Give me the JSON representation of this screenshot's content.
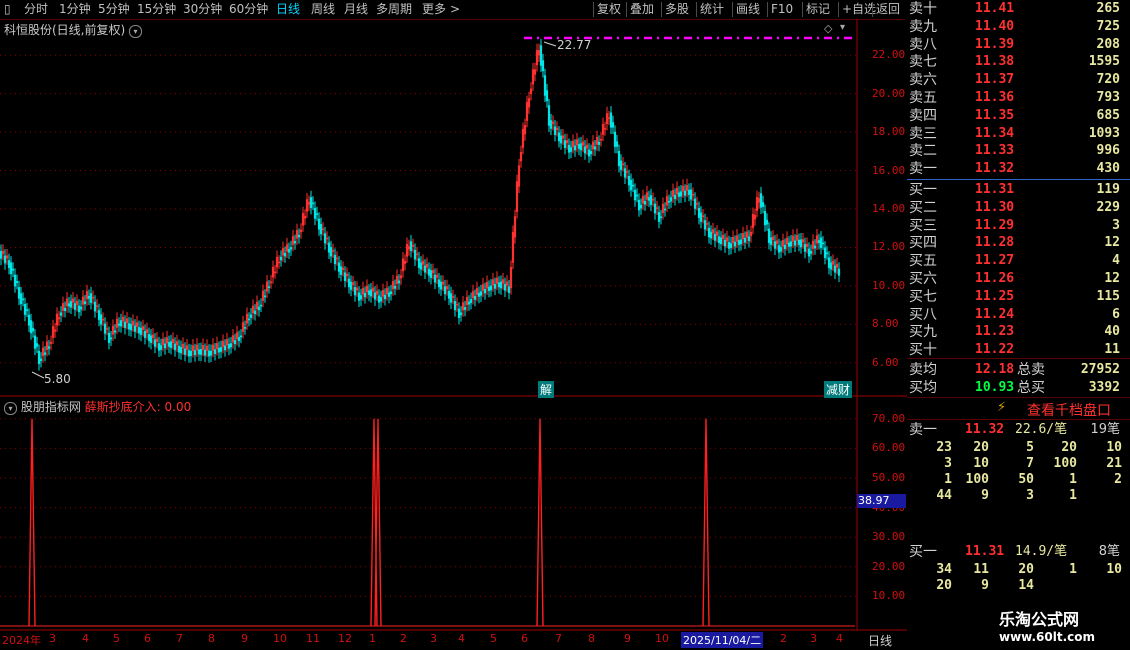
{
  "toolbar": {
    "periods": [
      "分时",
      "1分钟",
      "5分钟",
      "15分钟",
      "30分钟",
      "60分钟",
      "日线",
      "周线",
      "月线",
      "多周期",
      "更多"
    ],
    "active_period": "日线",
    "actions": [
      "复权",
      "叠加",
      "多股",
      "统计",
      "画线",
      "F10",
      "标记",
      "+自选",
      "返回"
    ]
  },
  "stock": {
    "title": "科恒股份(日线,前复权)",
    "high_label": "22.77",
    "low_label": "5.80",
    "badge_left": "解",
    "badge_right": "减财"
  },
  "indicator": {
    "panel_title": "股朋指标网",
    "name": "薛斯抄底介入: 0.00",
    "current_value": "38.97"
  },
  "bottom_axis": {
    "labels": [
      "2024年",
      "3",
      "4",
      "5",
      "6",
      "7",
      "8",
      "9",
      "10",
      "11",
      "12",
      "1",
      "2",
      "3",
      "4",
      "5",
      "6",
      "7",
      "8",
      "9",
      "10",
      "2025/11/04/二",
      "2",
      "3",
      "4"
    ],
    "period_label": "日线"
  },
  "chart_data": [
    {
      "type": "line",
      "name": "price",
      "ylim": [
        5,
        23
      ],
      "yticks": [
        "6.00",
        "8.00",
        "10.00",
        "12.00",
        "14.00",
        "16.00",
        "18.00",
        "20.00",
        "22.00"
      ],
      "x": [
        0,
        10,
        20,
        30,
        40,
        50,
        60,
        70,
        80,
        90,
        100,
        110,
        120,
        130,
        140,
        150,
        160,
        170,
        180,
        190,
        200,
        210,
        220,
        230,
        240,
        250,
        260,
        270,
        280,
        290,
        300,
        310,
        320,
        330,
        340,
        350,
        360,
        370,
        380,
        390,
        400,
        410,
        420,
        430,
        440,
        450,
        460,
        470,
        480,
        490,
        500,
        510,
        520,
        530,
        540,
        550,
        560,
        570,
        580,
        590,
        600,
        610,
        620,
        630,
        640,
        650,
        660,
        670,
        680,
        690,
        700,
        710,
        720,
        730,
        740,
        750,
        760,
        770,
        780,
        790,
        800,
        810,
        820,
        830,
        840
      ],
      "values": [
        11.8,
        11.2,
        9.6,
        8.2,
        6.2,
        7.0,
        8.6,
        9.2,
        8.9,
        9.6,
        8.5,
        7.3,
        8.2,
        8.0,
        7.8,
        7.4,
        6.9,
        7.1,
        6.8,
        6.6,
        6.7,
        6.6,
        6.8,
        7.0,
        7.4,
        8.5,
        9.0,
        10.2,
        11.5,
        12.0,
        12.8,
        14.6,
        13.2,
        12.0,
        11.0,
        10.2,
        9.5,
        9.8,
        9.4,
        9.7,
        10.4,
        12.3,
        11.2,
        10.8,
        10.2,
        9.6,
        8.6,
        9.3,
        9.7,
        10.0,
        10.2,
        9.9,
        16.5,
        20.0,
        22.5,
        18.6,
        17.8,
        17.2,
        17.4,
        17.0,
        17.6,
        19.0,
        16.5,
        15.5,
        14.2,
        14.7,
        13.6,
        14.6,
        14.9,
        15.0,
        13.8,
        12.8,
        12.5,
        12.2,
        12.4,
        12.6,
        14.8,
        12.5,
        12.0,
        12.3,
        12.4,
        11.8,
        12.5,
        11.2,
        10.8
      ]
    },
    {
      "type": "bar",
      "name": "indicator",
      "ylim": [
        0,
        75
      ],
      "yticks": [
        "10.00",
        "20.00",
        "30.00",
        "40.00",
        "50.00",
        "60.00",
        "70.00"
      ],
      "x": [
        32,
        374,
        378,
        540,
        706
      ],
      "values": [
        70,
        70,
        70,
        70,
        70
      ]
    }
  ],
  "orderbook": {
    "sell": [
      {
        "label": "卖十",
        "price": "11.41",
        "vol": "265"
      },
      {
        "label": "卖九",
        "price": "11.40",
        "vol": "725"
      },
      {
        "label": "卖八",
        "price": "11.39",
        "vol": "208"
      },
      {
        "label": "卖七",
        "price": "11.38",
        "vol": "1595"
      },
      {
        "label": "卖六",
        "price": "11.37",
        "vol": "720"
      },
      {
        "label": "卖五",
        "price": "11.36",
        "vol": "793"
      },
      {
        "label": "卖四",
        "price": "11.35",
        "vol": "685"
      },
      {
        "label": "卖三",
        "price": "11.34",
        "vol": "1093"
      },
      {
        "label": "卖二",
        "price": "11.33",
        "vol": "996"
      },
      {
        "label": "卖一",
        "price": "11.32",
        "vol": "430"
      }
    ],
    "buy": [
      {
        "label": "买一",
        "price": "11.31",
        "vol": "119"
      },
      {
        "label": "买二",
        "price": "11.30",
        "vol": "229"
      },
      {
        "label": "买三",
        "price": "11.29",
        "vol": "3"
      },
      {
        "label": "买四",
        "price": "11.28",
        "vol": "12"
      },
      {
        "label": "买五",
        "price": "11.27",
        "vol": "4"
      },
      {
        "label": "买六",
        "price": "11.26",
        "vol": "12"
      },
      {
        "label": "买七",
        "price": "11.25",
        "vol": "115"
      },
      {
        "label": "买八",
        "price": "11.24",
        "vol": "6"
      },
      {
        "label": "买九",
        "price": "11.23",
        "vol": "40"
      },
      {
        "label": "买十",
        "price": "11.22",
        "vol": "11"
      }
    ],
    "sell_avg_label": "卖均",
    "sell_avg": "12.18",
    "total_sell_label": "总卖",
    "total_sell": "27952",
    "buy_avg_label": "买均",
    "buy_avg": "10.93",
    "total_buy_label": "总买",
    "total_buy": "3392",
    "thousand_btn": "查看千档盘口",
    "sell1": {
      "label": "卖一",
      "price": "11.32",
      "avg": "22.6/笔",
      "count": "19笔"
    },
    "sell1_grid": [
      [
        "23",
        "20",
        "5",
        "20",
        "10"
      ],
      [
        "3",
        "10",
        "7",
        "100",
        "21"
      ],
      [
        "1",
        "100",
        "50",
        "1",
        "2"
      ],
      [
        "44",
        "9",
        "3",
        "1",
        ""
      ]
    ],
    "buy1": {
      "label": "买一",
      "price": "11.31",
      "avg": "14.9/笔",
      "count": "8笔"
    },
    "buy1_grid": [
      [
        "34",
        "11",
        "20",
        "1",
        "10"
      ],
      [
        "20",
        "9",
        "14",
        "",
        ""
      ]
    ]
  },
  "watermark": {
    "cn": "乐淘公式网",
    "url": "www.60lt.com"
  },
  "colors": {
    "up": "#ff3030",
    "down": "#00e5e5",
    "grid": "#8b0000",
    "accent": "#ff00ff"
  }
}
